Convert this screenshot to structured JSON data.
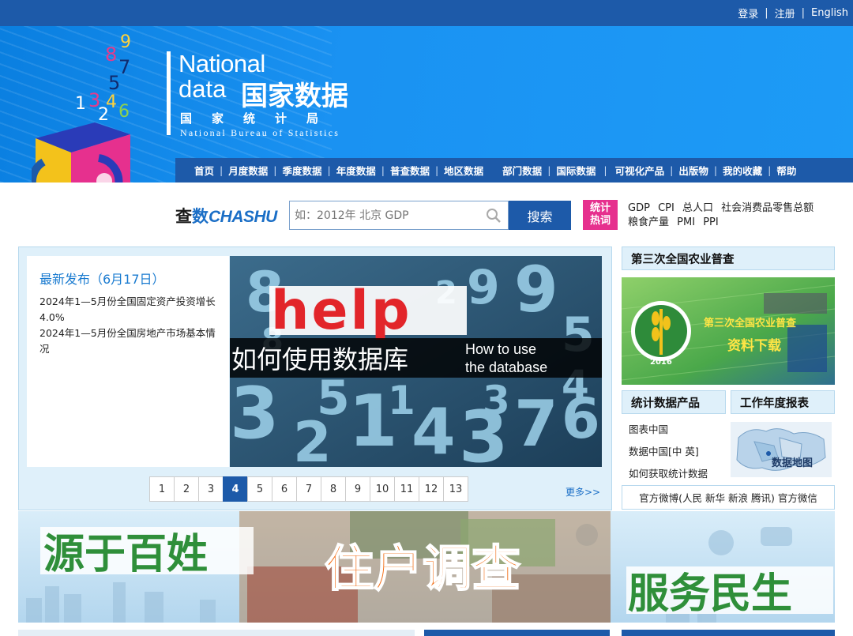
{
  "topbar": {
    "login": "登录",
    "register": "注册",
    "english": "English"
  },
  "brand": {
    "en_line1": "National",
    "en_line2": "data",
    "cn_big": "国家数据",
    "cn_small": "国家统计局",
    "en_full": "National Bureau of Statistics",
    "cube_numbers": [
      "9",
      "8",
      "7",
      "5",
      "1",
      "3",
      "4",
      "6",
      "2"
    ]
  },
  "nav": {
    "items": [
      "首页",
      "月度数据",
      "季度数据",
      "年度数据",
      "普查数据",
      "地区数据",
      "部门数据",
      "国际数据",
      "可视化产品",
      "出版物",
      "我的收藏",
      "帮助"
    ]
  },
  "search": {
    "logo_cn1": "查",
    "logo_cn2": "数",
    "logo_en": "CHASHU",
    "placeholder": "如：2012年 北京 GDP",
    "button": "搜索"
  },
  "hot": {
    "badge_line1": "统计",
    "badge_line2": "热词",
    "words": [
      "GDP",
      "CPI",
      "总人口",
      "社会消费品零售总额",
      "粮食产量",
      "PMI",
      "PPI"
    ]
  },
  "latest": {
    "title": "最新发布（6月17日）",
    "items": [
      "2024年1—5月份全国固定资产投资增长4.0%",
      "2024年1—5月份全国房地产市场基本情况"
    ]
  },
  "help_banner": {
    "help_word": "help",
    "cn_text": "如何使用数据库",
    "en_line1": "How to use",
    "en_line2": "the database",
    "bg_numbers": [
      "8",
      "9",
      "5",
      "3",
      "2",
      "1",
      "4",
      "3",
      "7",
      "6",
      "1",
      "5",
      "9",
      "8",
      "3",
      "2",
      "4"
    ]
  },
  "pager": {
    "pages": [
      "1",
      "2",
      "3",
      "4",
      "5",
      "6",
      "7",
      "8",
      "9",
      "10",
      "11",
      "12",
      "13"
    ],
    "active": "4",
    "more": "更多>>"
  },
  "right": {
    "census_title": "第三次全国农业普查",
    "census_banner_line1": "第三次全国农业普查",
    "census_banner_line2": "资料下载",
    "census_year": "2016",
    "products_title": "统计数据产品",
    "report_title": "工作年度报表",
    "products": [
      "图表中国",
      "数据中国[中 英]",
      "如何获取统计数据"
    ],
    "map_label": "数据地图",
    "weibo": "官方微博(人民 新华 新浪 腾讯) 官方微信"
  },
  "bottom_banner": {
    "left": "源于百姓",
    "middle": "住户调查",
    "right": "服务民生"
  },
  "colors": {
    "nav": "#1d5aa9",
    "header": "#1a92f2",
    "accent": "#1a7bd0",
    "hot": "#e6308e"
  }
}
